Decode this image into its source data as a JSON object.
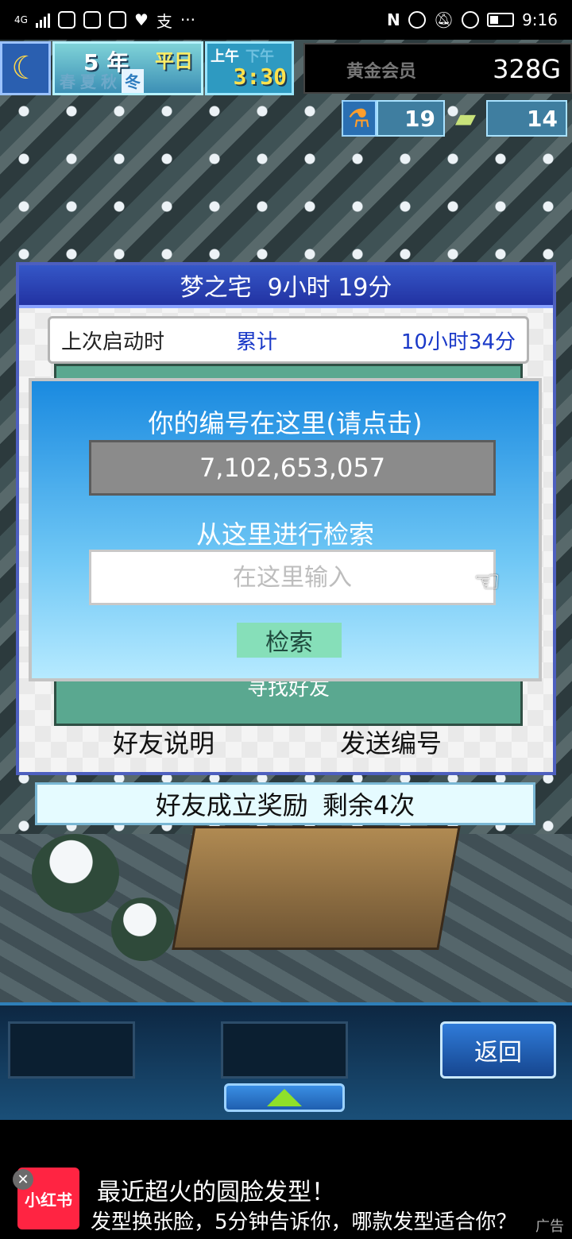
{
  "statusbar": {
    "network": "4G",
    "app_glyph": "支",
    "more": "···",
    "time": "9:16"
  },
  "hud": {
    "year": "5 年",
    "day_type": "平日",
    "seasons": [
      "春",
      "夏",
      "秋",
      "冬"
    ],
    "active_season": "冬",
    "am": "上午",
    "pm": "下午",
    "clock": "3:30",
    "membership": "黄金会员",
    "gold": "328G",
    "research": "19",
    "tickets": "14"
  },
  "panel": {
    "title_name": "梦之宅",
    "title_time": "9小时 19分",
    "last_launch_label": "上次启动时",
    "cumulative_label": "累计",
    "cumulative_value": "10小时34分",
    "find_friends": "寻找好友",
    "friend_help": "好友说明",
    "send_id": "发送编号"
  },
  "reward": {
    "label": "好友成立奖励",
    "remaining": "剩余4次"
  },
  "dialog": {
    "title": "你的编号在这里(请点击)",
    "player_id": "7,102,653,057",
    "search_title": "从这里进行检索",
    "search_placeholder": "在这里输入",
    "search_button": "检索"
  },
  "bottom": {
    "back_button": "返回"
  },
  "ad": {
    "brand": "小红书",
    "title": "最近超火的圆脸发型！",
    "body": "发型换张脸，5分钟告诉你，哪款发型适合你？",
    "tag": "广告"
  }
}
